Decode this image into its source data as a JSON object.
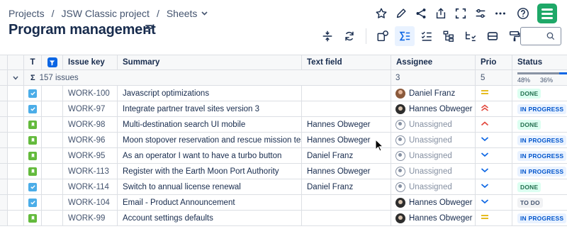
{
  "breadcrumb": {
    "items": [
      "Projects",
      "JSW Classic project",
      "Sheets"
    ],
    "separator": "/"
  },
  "page_title": "Program management",
  "top_icons": [
    "star-icon",
    "edit-icon",
    "share-icon",
    "export-icon",
    "fullscreen-icon",
    "settings-sliders-icon",
    "more-icon",
    "help-icon",
    "app-logo-icon"
  ],
  "toolbar_icons": [
    "collapse-rows-icon",
    "refresh-icon",
    "add-field-icon",
    "sum-icon",
    "checklist-icon",
    "hierarchy-icon",
    "filter-list-icon",
    "card-icon",
    "paint-icon"
  ],
  "search": {
    "placeholder": ""
  },
  "table": {
    "columns": [
      "T",
      "Issue key",
      "Summary",
      "Text field",
      "Assignee",
      "Prio",
      "Status"
    ],
    "summary": {
      "label": "157 issues",
      "assignee_count": "3",
      "prio_count": "5",
      "status_done_pct": "48%",
      "status_progress_pct": "36%",
      "status_fractions": {
        "done": 0.48,
        "in_progress": 0.36,
        "to_do": 0.16
      }
    },
    "rows": [
      {
        "type": "task",
        "key": "WORK-100",
        "summary": "Javascript optimizations",
        "text": "",
        "assignee": "Daniel Franz",
        "avatar": "person",
        "prio": "medium",
        "status": "DONE",
        "status_kind": "done"
      },
      {
        "type": "task",
        "key": "WORK-97",
        "summary": "Integrate partner travel sites version 3",
        "text": "",
        "assignee": "Hannes Obweger",
        "avatar": "person2",
        "prio": "highest",
        "status": "IN PROGRESS",
        "status_kind": "prog"
      },
      {
        "type": "story",
        "key": "WORK-98",
        "summary": "Multi-destination search UI mobile",
        "text": "Hannes Obweger",
        "assignee": "Unassigned",
        "avatar": "none",
        "prio": "high",
        "status": "DONE",
        "status_kind": "done"
      },
      {
        "type": "story",
        "key": "WORK-96",
        "summary": "Moon stopover reservation and rescue mission testing",
        "text": "Hannes Obweger",
        "assignee": "Unassigned",
        "avatar": "none",
        "prio": "low",
        "status": "IN PROGRESS",
        "status_kind": "prog"
      },
      {
        "type": "story",
        "key": "WORK-95",
        "summary": "As an operator I want to have a turbo button",
        "text": "Daniel Franz",
        "assignee": "Unassigned",
        "avatar": "none",
        "prio": "low",
        "status": "IN PROGRESS",
        "status_kind": "prog"
      },
      {
        "type": "story",
        "key": "WORK-113",
        "summary": "Register with the Earth Moon Port Authority",
        "text": "Hannes Obweger",
        "assignee": "Unassigned",
        "avatar": "none",
        "prio": "low",
        "status": "IN PROGRESS",
        "status_kind": "prog"
      },
      {
        "type": "task",
        "key": "WORK-114",
        "summary": "Switch to annual license renewal",
        "text": "Daniel Franz",
        "assignee": "Unassigned",
        "avatar": "none",
        "prio": "low",
        "status": "DONE",
        "status_kind": "done"
      },
      {
        "type": "task",
        "key": "WORK-104",
        "summary": "Email - Product Announcement",
        "text": "",
        "assignee": "Hannes Obweger",
        "avatar": "person2",
        "prio": "low",
        "status": "TO DO",
        "status_kind": "todo"
      },
      {
        "type": "story",
        "key": "WORK-99",
        "summary": "Account settings defaults",
        "text": "",
        "assignee": "Hannes Obweger",
        "avatar": "person2",
        "prio": "medium",
        "status": "IN PROGRESS",
        "status_kind": "prog"
      }
    ]
  },
  "colors": {
    "accent": "#0c66e4",
    "task": "#4bade8",
    "story": "#63ba3c",
    "prio_medium": "#e2b203",
    "prio_high": "#e2483d",
    "prio_low": "#0c66e4",
    "logo": "#1ea868"
  }
}
